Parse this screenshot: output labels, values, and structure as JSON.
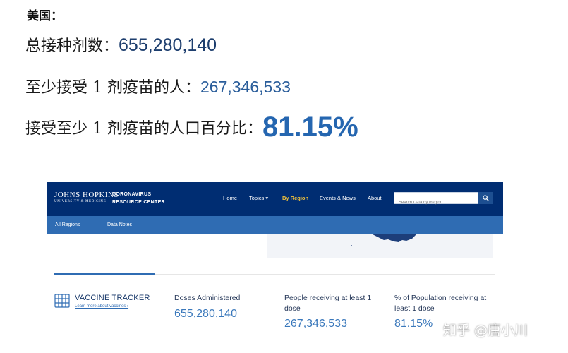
{
  "summary": {
    "country": "美国：",
    "doses_label": "总接种剂数：",
    "doses_value": "655,280,140",
    "people_label": "至少接受 1 剂疫苗的人：",
    "people_value": "267,346,533",
    "percent_label": "接受至少 1 剂疫苗的人口百分比：",
    "percent_value": "81.15%"
  },
  "jhu": {
    "logo_line1": "JOHNS HOPKINS",
    "logo_line2": "UNIVERSITY & MEDICINE",
    "center_line1": "CORONAVIRUS",
    "center_line2": "RESOURCE CENTER",
    "nav": {
      "home": "Home",
      "topics": "Topics ▾",
      "by_region": "By Region",
      "events": "Events & News",
      "about": "About"
    },
    "search_placeholder": "Search Data by Region",
    "subnav": {
      "all_regions": "All Regions",
      "data_notes": "Data Notes"
    },
    "tracker": {
      "title": "VACCINE TRACKER",
      "link": "Learn more about vaccines ›"
    },
    "metrics": [
      {
        "label": "Doses Administered",
        "value": "655,280,140"
      },
      {
        "label": "People receiving at least 1 dose",
        "value": "267,346,533"
      },
      {
        "label": "% of Population receiving at least 1 dose",
        "value": "81.15%"
      }
    ],
    "colors": {
      "header": "#002d72",
      "subnav": "#2f6cb3",
      "active_nav": "#f4c33a",
      "metric_value": "#3a78bb"
    }
  },
  "watermark": "知乎 @唐小川"
}
